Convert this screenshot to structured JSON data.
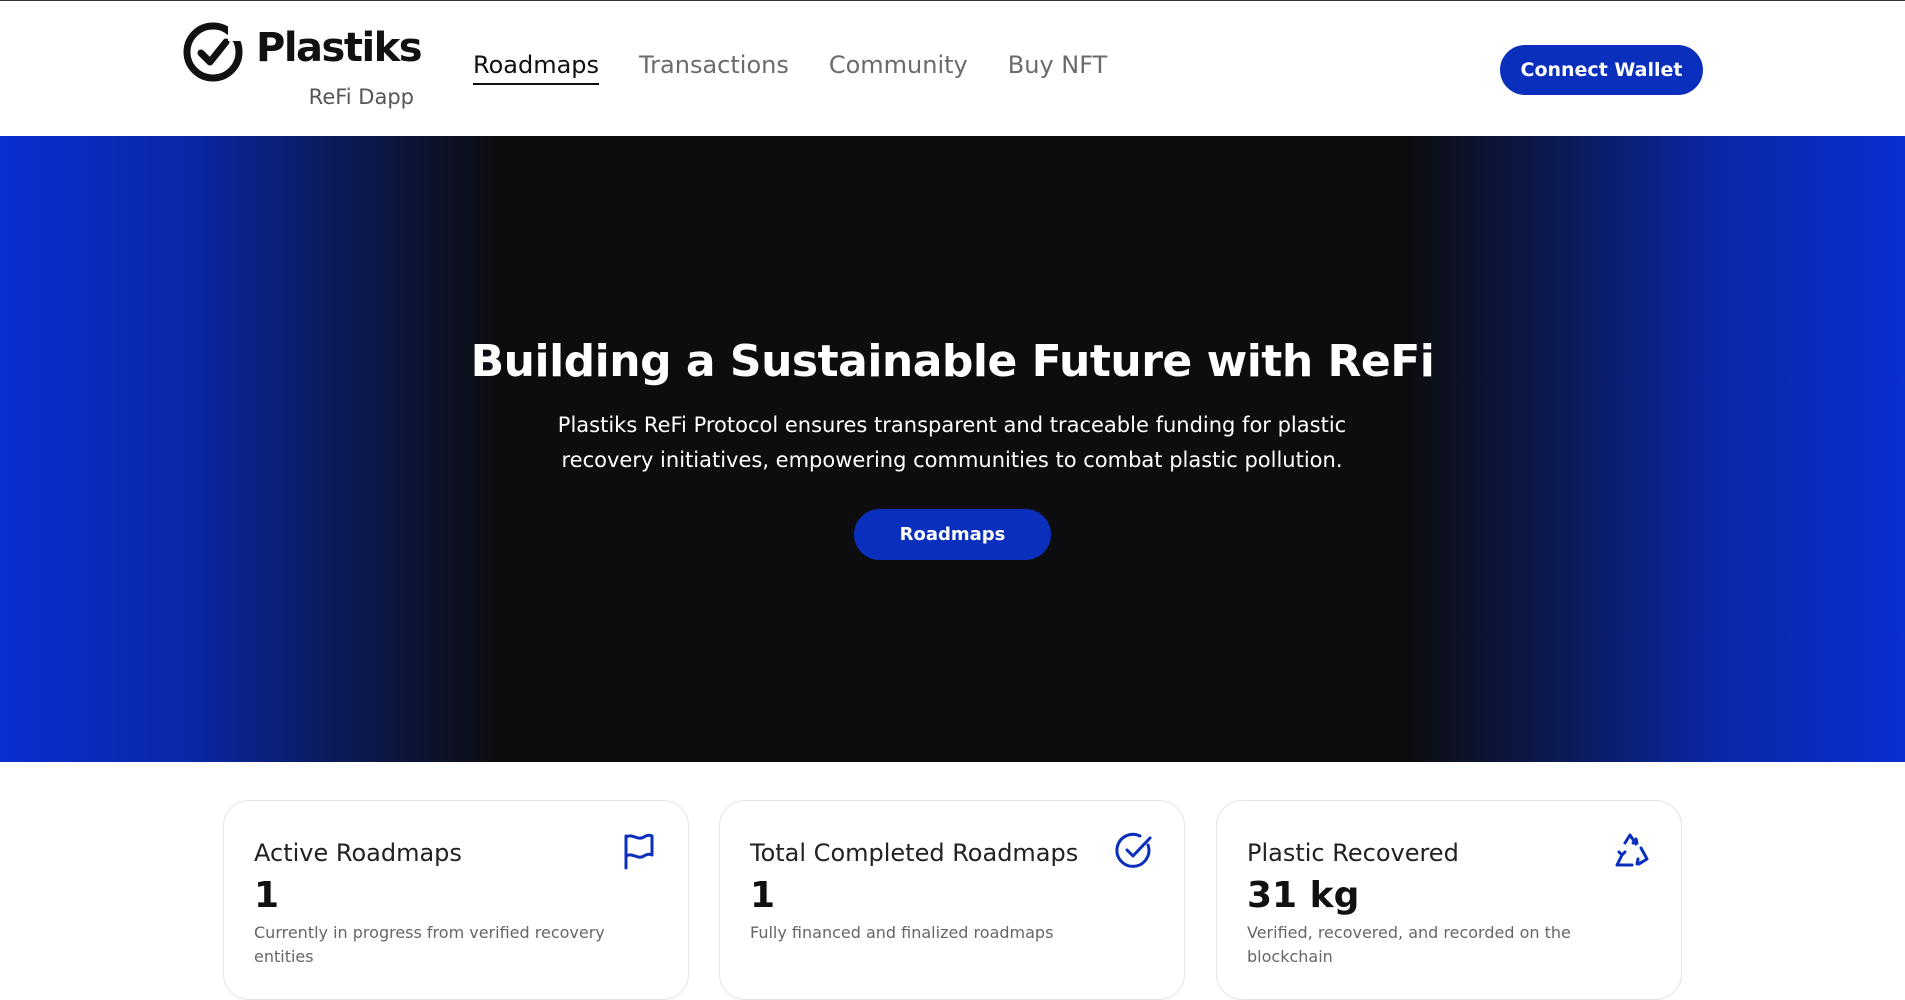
{
  "brand": {
    "name": "Plastiks",
    "subtitle": "ReFi Dapp"
  },
  "nav": {
    "items": [
      {
        "label": "Roadmaps",
        "active": true
      },
      {
        "label": "Transactions",
        "active": false
      },
      {
        "label": "Community",
        "active": false
      },
      {
        "label": "Buy NFT",
        "active": false
      }
    ]
  },
  "header": {
    "connect_label": "Connect Wallet"
  },
  "hero": {
    "title": "Building a Sustainable Future with ReFi",
    "description": "Plastiks ReFi Protocol ensures transparent and traceable funding for plastic recovery initiatives, empowering communities to combat plastic pollution.",
    "button_label": "Roadmaps"
  },
  "stats": [
    {
      "title": "Active Roadmaps",
      "value": "1",
      "description": "Currently in progress from verified recovery entities",
      "icon": "flag-icon"
    },
    {
      "title": "Total Completed Roadmaps",
      "value": "1",
      "description": "Fully financed and finalized roadmaps",
      "icon": "check-circle-icon"
    },
    {
      "title": "Plastic Recovered",
      "value": "31 kg",
      "description": "Verified, recovered, and recorded on the blockchain",
      "icon": "recycle-icon"
    }
  ],
  "colors": {
    "accent": "#0b2fbd",
    "hero_dark": "#0d0d10",
    "hero_edge": "#0a2ed0",
    "icon_blue": "#0b2fbd"
  }
}
